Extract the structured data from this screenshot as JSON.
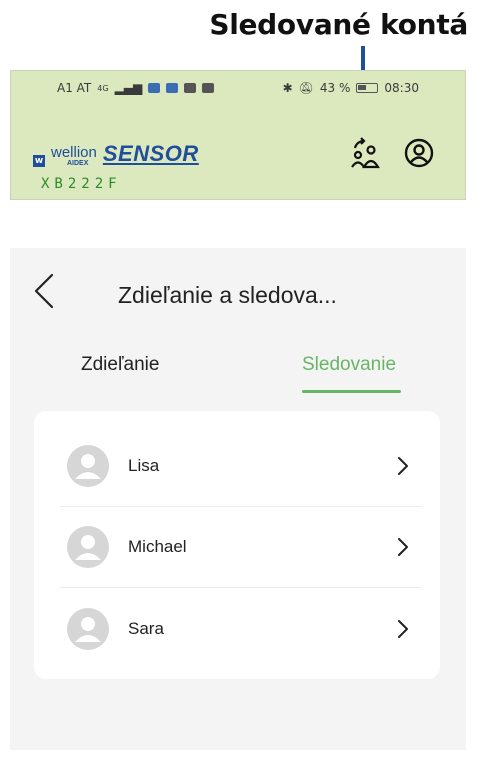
{
  "annotation": {
    "caption": "Sledované kontá",
    "arrow_color": "#1f4e9a"
  },
  "status_bar": {
    "carrier": "A1 AT",
    "network": "4G",
    "battery": "43 %",
    "time": "08:30"
  },
  "header": {
    "brand_prefix": "wellion",
    "brand_sub": "AIDEX",
    "brand_name": "SENSOR",
    "serial": "XB222F",
    "icons": [
      "switch-user-icon",
      "profile-icon"
    ]
  },
  "screen": {
    "title": "Zdieľanie a sledova...",
    "tabs": [
      {
        "label": "Zdieľanie",
        "active": false
      },
      {
        "label": "Sledovanie",
        "active": true
      }
    ],
    "accent_color": "#69b567",
    "contacts": [
      {
        "name": "Lisa"
      },
      {
        "name": "Michael"
      },
      {
        "name": "Sara"
      }
    ]
  }
}
